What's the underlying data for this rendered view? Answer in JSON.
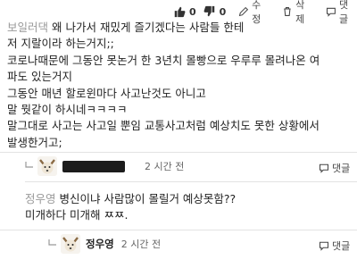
{
  "comment1": {
    "actions": {
      "likes": "0",
      "dislikes": "0",
      "edit_label": "수정",
      "delete_label": "삭제",
      "reply_label": "댓글"
    },
    "author": "보일러댁",
    "lines": [
      "왜 나가서 재밌게 즐기겠다는 사람들 한테",
      "저 지랄이라 하는거지;;",
      "코로나때문에 그동안 못논거 한 3년치 몰빵으로 우루루 몰려나온 여",
      "파도 있는거지",
      "그동안 매년 할로윈마다 사고난것도 아니고",
      "말 뭣같이 하시네ㅋㅋㅋㅋ",
      "말그대로 사고는 사고일 뿐임 교통사고처럼 예상치도 못한 상황에서",
      "발생한거고;"
    ]
  },
  "comment2": {
    "time": "2 시간 전",
    "reply_label": "댓글",
    "author": "정우영",
    "lines": [
      "병신이냐 사람많이 몰릴거 예상못함??",
      "미개하다 미개해 ㅉㅉ."
    ]
  },
  "comment3": {
    "username": "정우영",
    "time": "2 시간 전",
    "reply_label": "댓글"
  }
}
